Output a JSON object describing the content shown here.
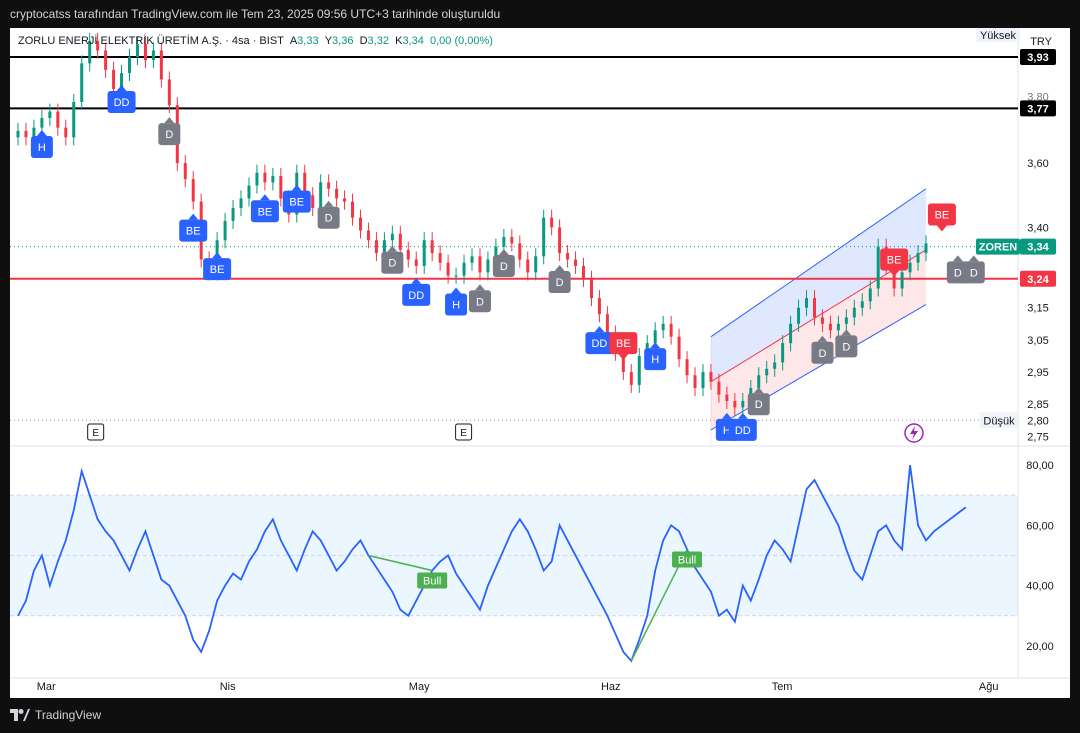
{
  "header": {
    "caption": "cryptocatss tarafından TradingView.com ile Tem 23, 2025 09:56 UTC+3 tarihinde oluşturuldu"
  },
  "legend": {
    "symbol": "ZORLU ENERJİ ELEKTRİK ÜRETİM A.Ş. · 4sa · BIST",
    "a_label": "A",
    "a_value": "3,33",
    "y_label": "Y",
    "y_value": "3,36",
    "d_label": "D",
    "d_value": "3,32",
    "k_label": "K",
    "k_value": "3,34",
    "change": "0,00 (0,00%)"
  },
  "currency": "TRY",
  "footer": {
    "brand": "TradingView"
  },
  "colors": {
    "up": "#089981",
    "down": "#f23645",
    "rsi": "#2962ff",
    "level_red": "#f23645",
    "channel": "#2962ff"
  },
  "chart_data": [
    {
      "type": "line",
      "name": "price",
      "x_labels": [
        "Mar",
        "Nis",
        "May",
        "Haz",
        "Tem",
        "Ağu"
      ],
      "y_ticks": [
        "3,60",
        "3,40",
        "3,15",
        "3,05",
        "2,95",
        "2,85",
        "2,75"
      ],
      "ylim": [
        2.72,
        4.02
      ],
      "close": [
        3.7,
        3.68,
        3.71,
        3.74,
        3.76,
        3.71,
        3.68,
        3.79,
        3.91,
        3.98,
        3.95,
        3.89,
        3.83,
        3.88,
        3.93,
        3.97,
        3.92,
        3.95,
        3.86,
        3.78,
        3.6,
        3.55,
        3.48,
        3.3,
        3.26,
        3.36,
        3.42,
        3.46,
        3.49,
        3.53,
        3.57,
        3.54,
        3.56,
        3.49,
        3.44,
        3.57,
        3.5,
        3.46,
        3.54,
        3.52,
        3.49,
        3.48,
        3.43,
        3.39,
        3.36,
        3.32,
        3.36,
        3.38,
        3.33,
        3.3,
        3.28,
        3.36,
        3.32,
        3.29,
        3.25,
        3.25,
        3.29,
        3.31,
        3.26,
        3.3,
        3.34,
        3.37,
        3.35,
        3.3,
        3.26,
        3.31,
        3.43,
        3.4,
        3.32,
        3.3,
        3.28,
        3.24,
        3.18,
        3.13,
        3.07,
        3.01,
        2.95,
        2.91,
        3.0,
        3.04,
        3.08,
        3.1,
        3.06,
        2.99,
        2.94,
        2.9,
        2.95,
        2.92,
        2.88,
        2.86,
        2.84,
        2.86,
        2.9,
        2.94,
        2.96,
        2.98,
        3.04,
        3.1,
        3.15,
        3.18,
        3.12,
        3.1,
        3.08,
        3.1,
        3.12,
        3.15,
        3.17,
        3.21,
        3.34,
        3.28,
        3.21,
        3.26,
        3.29,
        3.32,
        3.35
      ],
      "hlines": [
        {
          "value": 3.93,
          "label": "3,93",
          "color": "#000000"
        },
        {
          "value": 3.77,
          "label": "3,77",
          "color": "#000000"
        },
        {
          "value": 3.24,
          "label": "3,24",
          "color": "#f23645"
        }
      ],
      "last_price": {
        "symbol": "ZOREN",
        "value": 3.34,
        "label": "3,34"
      },
      "high_marker": {
        "label": "Yüksek"
      },
      "low_marker": {
        "label": "Düşük",
        "value": 2.8,
        "value_label": "2,80"
      },
      "partial_tick": "3,80",
      "channel": {
        "start_index": 87,
        "end_index": 114,
        "upper": [
          3.06,
          3.52
        ],
        "middle": [
          2.92,
          3.33
        ],
        "lower": [
          2.77,
          3.16
        ]
      },
      "signals": [
        {
          "i": 3,
          "label": "H",
          "kind": "buy"
        },
        {
          "i": 13,
          "label": "DD",
          "kind": "buy"
        },
        {
          "i": 19,
          "label": "D",
          "kind": "neutral"
        },
        {
          "i": 22,
          "label": "BE",
          "kind": "buy"
        },
        {
          "i": 25,
          "label": "BE",
          "kind": "buy"
        },
        {
          "i": 31,
          "label": "BE",
          "kind": "buy"
        },
        {
          "i": 35,
          "label": "BE",
          "kind": "buy"
        },
        {
          "i": 39,
          "label": "D",
          "kind": "neutral"
        },
        {
          "i": 47,
          "label": "D",
          "kind": "neutral"
        },
        {
          "i": 50,
          "label": "DD",
          "kind": "buy"
        },
        {
          "i": 55,
          "label": "H",
          "kind": "buy"
        },
        {
          "i": 58,
          "label": "D",
          "kind": "neutral"
        },
        {
          "i": 61,
          "label": "D",
          "kind": "neutral"
        },
        {
          "i": 68,
          "label": "D",
          "kind": "neutral"
        },
        {
          "i": 73,
          "label": "DD",
          "kind": "buy"
        },
        {
          "i": 76,
          "label": "BE",
          "kind": "sell"
        },
        {
          "i": 80,
          "label": "H",
          "kind": "buy"
        },
        {
          "i": 89,
          "label": "H",
          "kind": "buy"
        },
        {
          "i": 91,
          "label": "DD",
          "kind": "buy"
        },
        {
          "i": 93,
          "label": "D",
          "kind": "neutral"
        },
        {
          "i": 101,
          "label": "D",
          "kind": "neutral"
        },
        {
          "i": 104,
          "label": "D",
          "kind": "neutral"
        },
        {
          "i": 110,
          "label": "BE",
          "kind": "sell"
        },
        {
          "i": 116,
          "label": "BE",
          "kind": "sell"
        },
        {
          "i": 118,
          "label": "D",
          "kind": "neutral"
        },
        {
          "i": 120,
          "label": "D",
          "kind": "neutral"
        }
      ],
      "earnings": [
        {
          "x_fraction": 0.085,
          "label": "E"
        },
        {
          "x_fraction": 0.45,
          "label": "E"
        }
      ],
      "flash_icon": "lightning-icon"
    },
    {
      "type": "line",
      "name": "RSI",
      "y_ticks": [
        "80,00",
        "60,00",
        "40,00",
        "20,00"
      ],
      "ylim": [
        10,
        85
      ],
      "band": [
        30,
        70
      ],
      "midline": 50,
      "values": [
        30,
        35,
        45,
        50,
        40,
        48,
        55,
        65,
        78,
        70,
        62,
        58,
        55,
        50,
        45,
        52,
        58,
        50,
        42,
        40,
        35,
        30,
        22,
        18,
        25,
        35,
        40,
        44,
        42,
        48,
        52,
        58,
        62,
        55,
        50,
        45,
        52,
        58,
        55,
        50,
        45,
        48,
        52,
        55,
        50,
        46,
        42,
        38,
        32,
        30,
        35,
        40,
        45,
        48,
        50,
        44,
        40,
        36,
        32,
        40,
        46,
        52,
        58,
        62,
        58,
        52,
        45,
        48,
        60,
        55,
        50,
        45,
        40,
        35,
        30,
        24,
        18,
        15,
        22,
        30,
        45,
        55,
        60,
        58,
        52,
        46,
        42,
        38,
        30,
        32,
        28,
        40,
        35,
        42,
        50,
        55,
        52,
        48,
        60,
        72,
        75,
        70,
        65,
        60,
        52,
        45,
        42,
        50,
        58,
        60,
        55,
        52,
        80,
        60,
        55,
        58,
        60,
        62,
        64,
        66
      ],
      "bull_labels": [
        {
          "label": "Bull",
          "from_i": 44,
          "to_i": 52
        },
        {
          "label": "Bull",
          "from_i": 77,
          "to_i": 84
        }
      ]
    }
  ]
}
